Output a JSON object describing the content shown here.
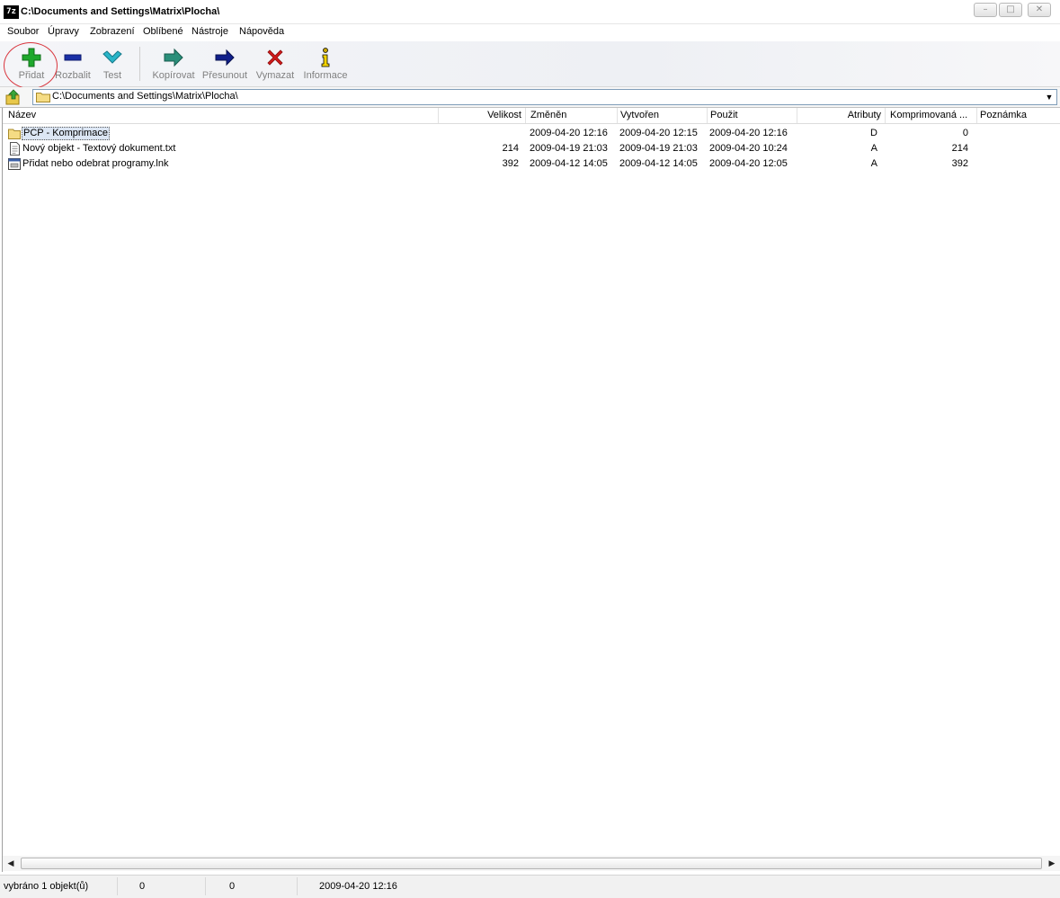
{
  "window": {
    "title": "C:\\Documents and Settings\\Matrix\\Plocha\\",
    "app_icon": "7z",
    "controls": {
      "minimize": "–",
      "maximize": "□",
      "close": "✕"
    }
  },
  "menu": {
    "items": [
      "Soubor",
      "Úpravy",
      "Zobrazení",
      "Oblíbené",
      "Nástroje",
      "Nápověda"
    ]
  },
  "toolbar": {
    "buttons": [
      {
        "label": "Přidat",
        "icon": "plus-icon",
        "color": "#1fa82c"
      },
      {
        "label": "Rozbalit",
        "icon": "minus-icon",
        "color": "#1a2fa6"
      },
      {
        "label": "Test",
        "icon": "check-icon",
        "color": "#2ab5c8"
      },
      {
        "label": "Kopírovat",
        "icon": "copy-arrow-icon",
        "color": "#2a8f7a"
      },
      {
        "label": "Přesunout",
        "icon": "move-arrow-icon",
        "color": "#101f8a"
      },
      {
        "label": "Vymazat",
        "icon": "delete-x-icon",
        "color": "#d11a1a"
      },
      {
        "label": "Informace",
        "icon": "info-icon",
        "color": "#c8a600"
      }
    ]
  },
  "address": {
    "path": "C:\\Documents and Settings\\Matrix\\Plocha\\"
  },
  "columns": [
    "Název",
    "Velikost",
    "Změněn",
    "Vytvořen",
    "Použit",
    "Atributy",
    "Komprimovaná ...",
    "Poznámka"
  ],
  "files": [
    {
      "name": "PCP - Komprimace",
      "size": "",
      "modified": "2009-04-20 12:16",
      "created": "2009-04-20 12:15",
      "accessed": "2009-04-20 12:16",
      "attributes": "D",
      "packed": "0",
      "comment": "",
      "type": "folder"
    },
    {
      "name": "Nový objekt - Textový dokument.txt",
      "size": "214",
      "modified": "2009-04-19 21:03",
      "created": "2009-04-19 21:03",
      "accessed": "2009-04-20 10:24",
      "attributes": "A",
      "packed": "214",
      "comment": "",
      "type": "text"
    },
    {
      "name": "Přidat nebo odebrat programy.lnk",
      "size": "392",
      "modified": "2009-04-12 14:05",
      "created": "2009-04-12 14:05",
      "accessed": "2009-04-20 12:05",
      "attributes": "A",
      "packed": "392",
      "comment": "",
      "type": "shortcut"
    }
  ],
  "status": {
    "selection": "vybráno 1 objekt(ů)",
    "size": "0",
    "packed": "0",
    "date": "2009-04-20 12:16"
  }
}
